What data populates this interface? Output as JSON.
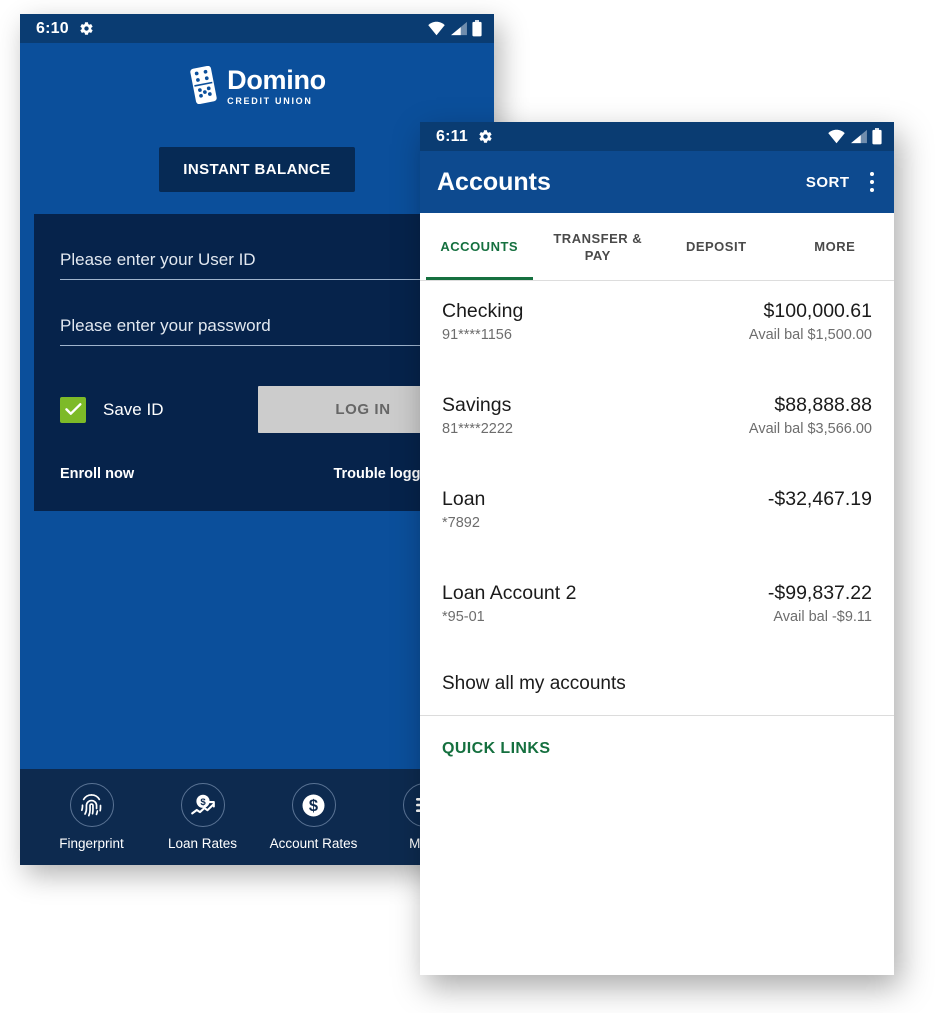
{
  "login_screen": {
    "status_bar": {
      "time": "6:10",
      "gear_icon": "gear-icon",
      "wifi_icon": "wifi-icon",
      "signal_icon": "signal-icon",
      "battery_icon": "battery-icon"
    },
    "brand": {
      "name": "Domino",
      "tagline": "CREDIT UNION",
      "logo_icon": "domino-tile-icon"
    },
    "instant_balance_label": "INSTANT BALANCE",
    "user_id_field": {
      "value": "",
      "placeholder": "Please enter your User ID"
    },
    "password_field": {
      "value": "",
      "placeholder": "Please enter your password"
    },
    "save_id_label": "Save ID",
    "save_id_checked": true,
    "login_button_label": "LOG IN",
    "enroll_link": "Enroll now",
    "trouble_link": "Trouble logging in?",
    "bottom_nav": [
      {
        "label": "Fingerprint",
        "icon": "fingerprint-icon"
      },
      {
        "label": "Loan Rates",
        "icon": "dollar-trend-icon"
      },
      {
        "label": "Account Rates",
        "icon": "dollar-coin-icon"
      },
      {
        "label": "More",
        "icon": "hamburger-menu-icon"
      }
    ],
    "colors": {
      "background": "#0b4f9b",
      "panel": "#06234b",
      "status_bar": "#0a3c72",
      "bottom_nav": "#0d2a4f",
      "checkbox_green": "#7dba28",
      "button_gray": "#cccccc"
    }
  },
  "accounts_screen": {
    "status_bar": {
      "time": "6:11",
      "gear_icon": "gear-icon",
      "wifi_icon": "wifi-icon",
      "signal_icon": "signal-icon",
      "battery_icon": "battery-icon"
    },
    "app_bar": {
      "title": "Accounts",
      "sort_label": "SORT",
      "overflow_icon": "overflow-menu-icon"
    },
    "tabs": [
      {
        "label": "ACCOUNTS",
        "active": true
      },
      {
        "label": "TRANSFER & PAY",
        "active": false
      },
      {
        "label": "DEPOSIT",
        "active": false
      },
      {
        "label": "MORE",
        "active": false
      }
    ],
    "accounts": [
      {
        "name": "Checking",
        "number": "91****1156",
        "balance": "$100,000.61",
        "available": "Avail bal $1,500.00"
      },
      {
        "name": "Savings",
        "number": "81****2222",
        "balance": "$88,888.88",
        "available": "Avail bal $3,566.00"
      },
      {
        "name": "Loan",
        "number": "*7892",
        "balance": "-$32,467.19",
        "available": ""
      },
      {
        "name": "Loan Account 2",
        "number": "*95-01",
        "balance": "-$99,837.22",
        "available": "Avail bal -$9.11"
      }
    ],
    "show_all_label": "Show all my accounts",
    "quick_links_label": "QUICK LINKS",
    "colors": {
      "app_bar": "#0d4a8f",
      "accent_green": "#15703f",
      "status_bar": "#0a3c72",
      "background": "#ffffff"
    }
  }
}
